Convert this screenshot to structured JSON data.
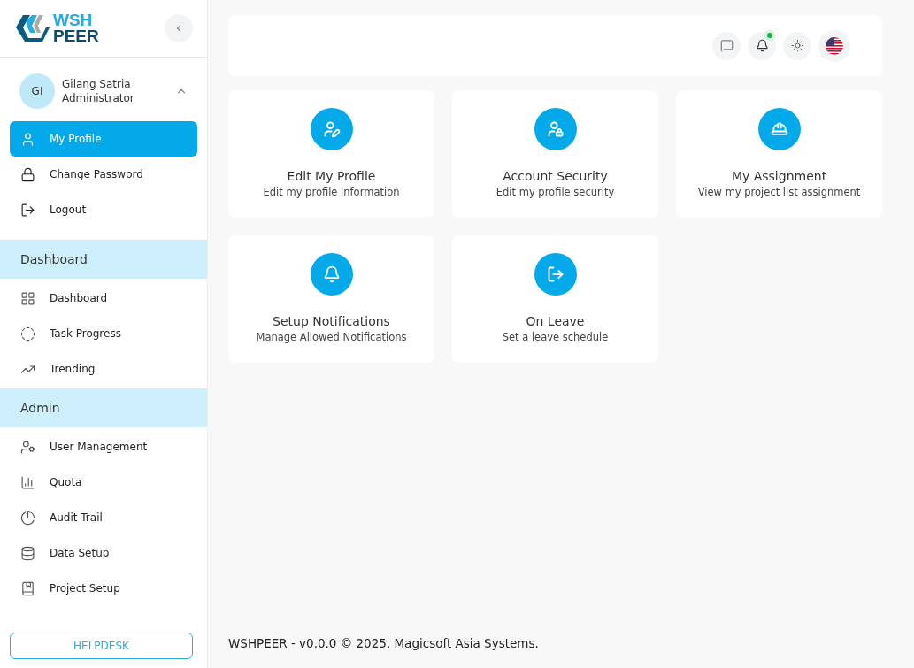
{
  "logo": {
    "line_1": "WSH",
    "line_2": "PEER"
  },
  "user": {
    "initials": "GI",
    "name": "Gilang Satria",
    "role": "Administrator",
    "expanded": true
  },
  "profile_menu": [
    {
      "label": "My Profile",
      "selected": true
    },
    {
      "label": "Change Password",
      "selected": false
    },
    {
      "label": "Logout",
      "selected": false
    }
  ],
  "groups": [
    {
      "title": "Dashboard",
      "items": [
        {
          "label": "Dashboard",
          "selected": false
        },
        {
          "label": "Task Progress",
          "selected": false
        },
        {
          "label": "Trending",
          "selected": false
        }
      ]
    },
    {
      "title": "Admin",
      "items": [
        {
          "label": "User Management",
          "selected": false
        },
        {
          "label": "Quota",
          "selected": false
        },
        {
          "label": "Audit Trail",
          "selected": false
        },
        {
          "label": "Data Setup",
          "selected": false
        },
        {
          "label": "Project Setup",
          "selected": false
        }
      ]
    }
  ],
  "helpdesk": "HELPDESK",
  "header": {
    "notification": true
  },
  "cards": [
    {
      "title": "Edit My Profile",
      "subtitle": "Edit my profile information"
    },
    {
      "title": "Account Security",
      "subtitle": "Edit my profile security"
    },
    {
      "title": "My Assignment",
      "subtitle": "View my project list assignment"
    },
    {
      "title": "Setup Notifications",
      "subtitle": "Manage Allowed Notifications"
    },
    {
      "title": "On Leave",
      "subtitle": "Set a leave schedule"
    }
  ],
  "footer": "WSHPEER - v0.0.0 © 2025. Magicsoft Asia Systems."
}
